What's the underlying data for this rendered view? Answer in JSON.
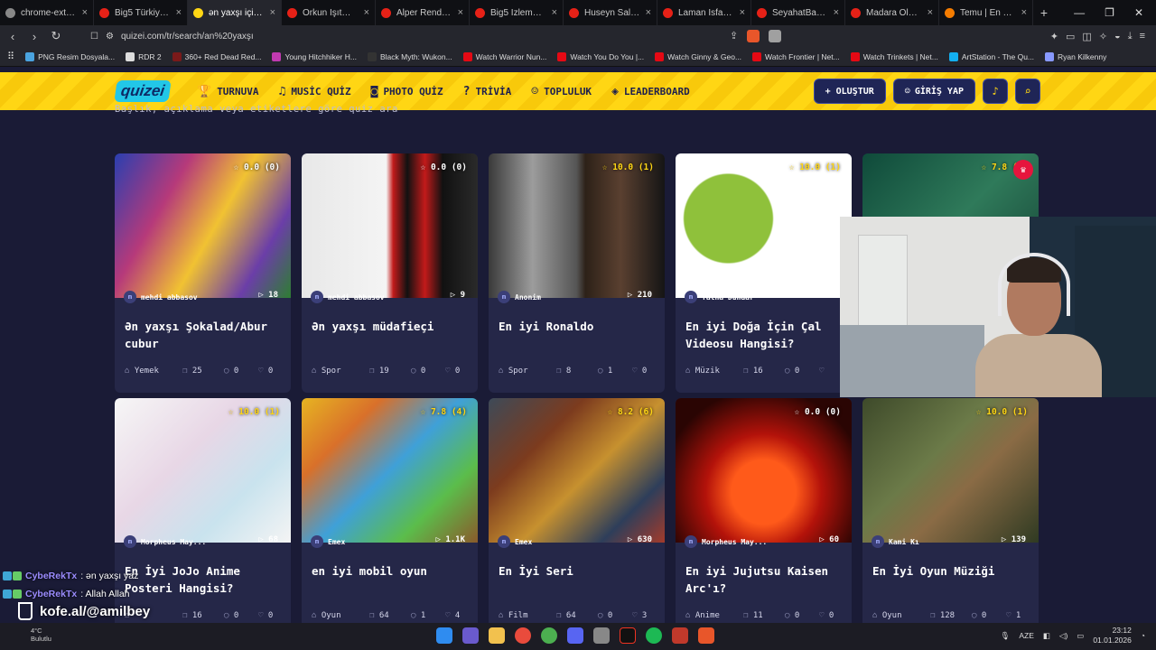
{
  "browser": {
    "tabs": [
      {
        "label": "chrome-extension:/",
        "color": "#888888",
        "active": false
      },
      {
        "label": "Big5 Türkiye - YouTu",
        "color": "#e62117",
        "active": false
      },
      {
        "label": "ən yaxşı için arı",
        "color": "#ffd614",
        "active": true
      },
      {
        "label": "Orkun Işıtmak - You",
        "color": "#e62117",
        "active": false
      },
      {
        "label": "Alper Rende - YouTu",
        "color": "#e62117",
        "active": false
      },
      {
        "label": "Big5 İzleme Partisi",
        "color": "#e62117",
        "active": false
      },
      {
        "label": "Huseyn Salmanov",
        "color": "#e62117",
        "active": false
      },
      {
        "label": "Laman İsfandiyarov",
        "color": "#e62117",
        "active": false
      },
      {
        "label": "SeyahatBakuAzerba",
        "color": "#e62117",
        "active": false
      },
      {
        "label": "Madara Olduk - You",
        "color": "#e62117",
        "active": false
      },
      {
        "label": "Temu | En Yeni Giyi",
        "color": "#f57c00",
        "active": false
      }
    ],
    "url": "quizei.com/tr/search/an%20yaxşı",
    "bookmarks": [
      {
        "label": "PNG Resim Dosyala...",
        "color": "#4aa3df"
      },
      {
        "label": "RDR 2",
        "color": "#dddddd"
      },
      {
        "label": "360+ Red Dead Red...",
        "color": "#7a1a1a"
      },
      {
        "label": "Young Hitchhiker H...",
        "color": "#c03ab0"
      },
      {
        "label": "Black Myth: Wukon...",
        "color": "#333333"
      },
      {
        "label": "Watch Warrior Nun...",
        "color": "#e50914"
      },
      {
        "label": "Watch You Do You |...",
        "color": "#e50914"
      },
      {
        "label": "Watch Ginny & Geo...",
        "color": "#e50914"
      },
      {
        "label": "Watch Frontier | Net...",
        "color": "#e50914"
      },
      {
        "label": "Watch Trinkets | Net...",
        "color": "#e50914"
      },
      {
        "label": "ArtStation - The Qu...",
        "color": "#13aff0"
      },
      {
        "label": "Ryan Kilkenny",
        "color": "#8899ff"
      }
    ]
  },
  "site": {
    "logo": "quizei",
    "nav": [
      {
        "label": "TURNUVA",
        "icon": "trophy-icon",
        "glyph": "🏆"
      },
      {
        "label": "MUSİC QUİZ",
        "icon": "music-icon",
        "glyph": "♫"
      },
      {
        "label": "PHOTO QUİZ",
        "icon": "camera-icon",
        "glyph": "◙"
      },
      {
        "label": "TRİVİA",
        "icon": "chat-icon",
        "glyph": "?"
      },
      {
        "label": "TOPLULUK",
        "icon": "people-icon",
        "glyph": "☺"
      },
      {
        "label": "LEADERBOARD",
        "icon": "shield-icon",
        "glyph": "◈"
      }
    ],
    "create_label": "+ OLUŞTUR",
    "login_label": "GİRİŞ YAP",
    "subtext": "Başlık, açıklama veya etiketlere göre quiz ara"
  },
  "cards": [
    {
      "rating": "0.0 (0)",
      "author": "mehdi abbasov",
      "plays": "18",
      "title": "Ən yaxşı Şokalad/Abur cubur",
      "category": "Yemek",
      "questions": "25",
      "comments": "0",
      "likes": "0",
      "thumb": "linear-gradient(120deg,#2a3fb0 0%,#b63a7a 30%,#f1c232 55%,#6b3ea8 80%,#2e7d32 100%)",
      "ratingGold": false
    },
    {
      "rating": "0.0 (0)",
      "author": "mehdi abbasov",
      "plays": "9",
      "title": "Ən yaxşı müdafieçi",
      "category": "Spor",
      "questions": "19",
      "comments": "0",
      "likes": "0",
      "thumb": "linear-gradient(90deg,#e8e8e8 0%,#f4f4f4 48%,#c21a1a 52%,#111 60%,#c21a1a 70%,#111 80%,#2a2a2a 100%)",
      "ratingGold": false
    },
    {
      "rating": "10.0 (1)",
      "author": "Anonim",
      "plays": "210",
      "title": "En iyi Ronaldo",
      "category": "Spor",
      "questions": "8",
      "comments": "1",
      "likes": "0",
      "thumb": "linear-gradient(90deg,#3a3a3a 0%,#9c9c9c 25%,#555 50%,#2d2118 55%,#5a4030 75%,#151515 100%)",
      "ratingGold": true
    },
    {
      "rating": "10.0 (1)",
      "author": "Talha Dündar",
      "plays": "9",
      "title": "En iyi Doğa İçin Çal Videosu Hangisi?",
      "category": "Müzik",
      "questions": "16",
      "comments": "0",
      "likes": "",
      "thumb": "radial-gradient(circle at 30% 45%,#8fc13b 0 30%,#ffffff 31% 100%)",
      "ratingGold": true
    },
    {
      "rating": "7.8 (4)",
      "author": "",
      "plays": "",
      "title": "",
      "category": "",
      "questions": "",
      "comments": "",
      "likes": "",
      "thumb": "linear-gradient(135deg,#0f4a3a 0%,#2f7a5a 50%,#143f33 100%)",
      "ratingGold": true
    },
    {
      "rating": "10.0 (1)",
      "author": "Morpheus May...",
      "plays": "68",
      "title": "En İyi JoJo Anime Posteri Hangisi?",
      "category": "",
      "questions": "16",
      "comments": "0",
      "likes": "0",
      "thumb": "linear-gradient(135deg,#f6f6f6 0%,#e8d7e6 40%,#c9e3ee 70%,#f4f4f4 100%)",
      "ratingGold": true
    },
    {
      "rating": "7.8 (4)",
      "author": "Emex",
      "plays": "1.1K",
      "title": "en iyi mobil oyun",
      "category": "Oyun",
      "questions": "64",
      "comments": "1",
      "likes": "4",
      "thumb": "linear-gradient(135deg,#e6b422 0%,#d9702a 25%,#3fa0d8 50%,#5bbd4b 75%,#8a5a2b 100%)",
      "ratingGold": true
    },
    {
      "rating": "8.2 (6)",
      "author": "Emex",
      "plays": "630",
      "title": "En İyi Seri",
      "category": "Film",
      "questions": "64",
      "comments": "0",
      "likes": "3",
      "thumb": "linear-gradient(135deg,#3d4a58 0%,#7c3b1e 30%,#c7912f 55%,#2e3e5a 80%,#a33b2b 100%)",
      "ratingGold": true
    },
    {
      "rating": "0.0 (0)",
      "author": "Morpheus May...",
      "plays": "60",
      "title": "En iyi Jujutsu Kaisen Arc'ı?",
      "category": "Anime",
      "questions": "11",
      "comments": "0",
      "likes": "0",
      "thumb": "radial-gradient(circle at 50% 65%,#ff5a1a 0 25%,#b3120a 45%,#2a0503 80%)",
      "ratingGold": false
    },
    {
      "rating": "10.0 (1)",
      "author": "Kami Kı",
      "plays": "139",
      "title": "En İyi Oyun Müziği",
      "category": "Oyun",
      "questions": "128",
      "comments": "0",
      "likes": "1",
      "thumb": "linear-gradient(135deg,#3e4a2a 0%,#6b7a48 40%,#8a6b45 60%,#2f3a22 100%)",
      "ratingGold": true
    }
  ],
  "chat": {
    "lines": [
      {
        "user": "CybeRekTx",
        "text": ": ən yaxşı yaz"
      },
      {
        "user": "CybeRekTx",
        "text": ": Allah Allah"
      }
    ],
    "overlay": "kofe.al/@amilbey"
  },
  "taskbar": {
    "weather_temp": "4°C",
    "weather_desc": "Bulutlu",
    "lang": "AZE",
    "time": "23:12",
    "date": "01.01.2026"
  }
}
